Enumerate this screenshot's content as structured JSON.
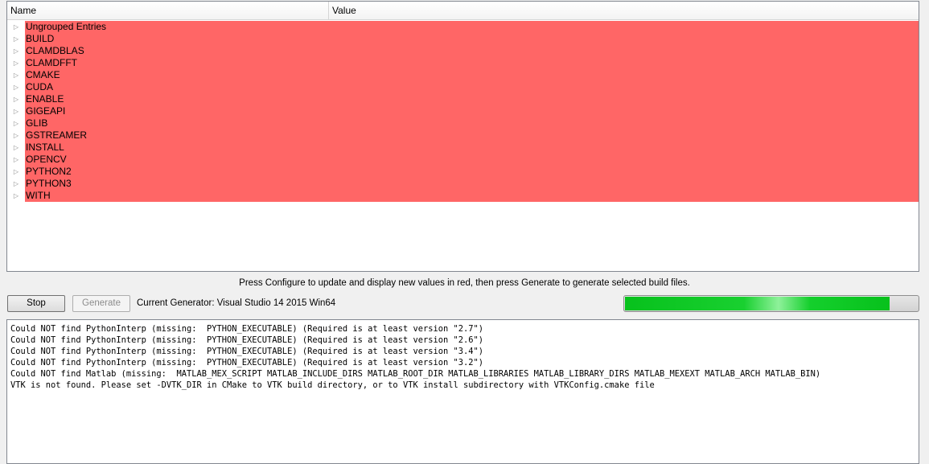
{
  "tree": {
    "columns": {
      "name": "Name",
      "value": "Value"
    },
    "highlight_color": "#ff6666",
    "entries": [
      "Ungrouped Entries",
      "BUILD",
      "CLAMDBLAS",
      "CLAMDFFT",
      "CMAKE",
      "CUDA",
      "ENABLE",
      "GIGEAPI",
      "GLIB",
      "GSTREAMER",
      "INSTALL",
      "OPENCV",
      "PYTHON2",
      "PYTHON3",
      "WITH"
    ]
  },
  "hint": "Press Configure to update and display new values in red, then press Generate to generate selected build files.",
  "toolbar": {
    "stop_label": "Stop",
    "generate_label": "Generate",
    "generator_text": "Current Generator: Visual Studio 14 2015 Win64",
    "progress": 0.905,
    "progress_color": "#13c52a"
  },
  "log": [
    "Could NOT find PythonInterp (missing:  PYTHON_EXECUTABLE) (Required is at least version \"2.7\")",
    "Could NOT find PythonInterp (missing:  PYTHON_EXECUTABLE) (Required is at least version \"2.6\")",
    "Could NOT find PythonInterp (missing:  PYTHON_EXECUTABLE) (Required is at least version \"3.4\")",
    "Could NOT find PythonInterp (missing:  PYTHON_EXECUTABLE) (Required is at least version \"3.2\")",
    "Could NOT find Matlab (missing:  MATLAB_MEX_SCRIPT MATLAB_INCLUDE_DIRS MATLAB_ROOT_DIR MATLAB_LIBRARIES MATLAB_LIBRARY_DIRS MATLAB_MEXEXT MATLAB_ARCH MATLAB_BIN)",
    "VTK is not found. Please set -DVTK_DIR in CMake to VTK build directory, or to VTK install subdirectory with VTKConfig.cmake file"
  ]
}
